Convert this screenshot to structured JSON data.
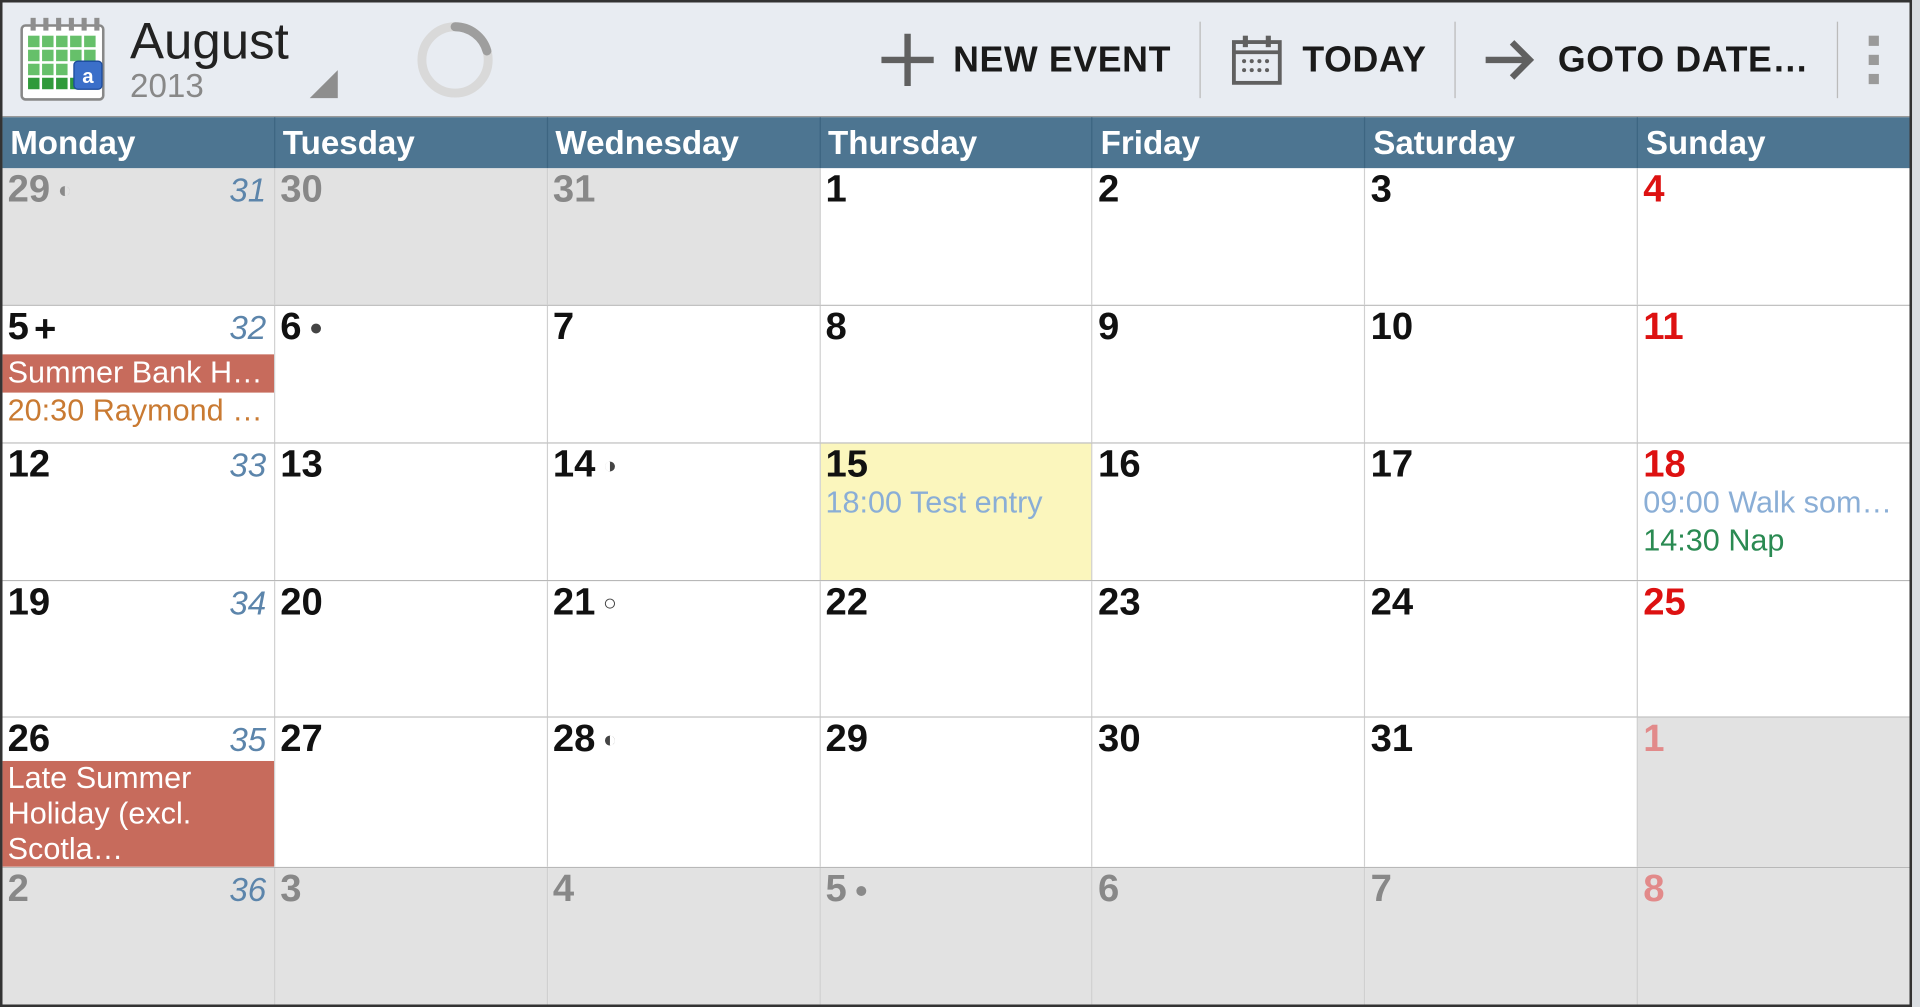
{
  "header": {
    "month": "August",
    "year": "2013",
    "actions": {
      "new_event": "NEW EVENT",
      "today": "TODAY",
      "goto_date": "GOTO DATE…"
    }
  },
  "weekdays": [
    "Monday",
    "Tuesday",
    "Wednesday",
    "Thursday",
    "Friday",
    "Saturday",
    "Sunday"
  ],
  "weeks": [
    {
      "wknum": "31",
      "days": [
        {
          "n": "29",
          "other": true,
          "moon": "◐"
        },
        {
          "n": "30",
          "other": true
        },
        {
          "n": "31",
          "other": true
        },
        {
          "n": "1"
        },
        {
          "n": "2"
        },
        {
          "n": "3"
        },
        {
          "n": "4",
          "sunday": true
        }
      ]
    },
    {
      "wknum": "32",
      "days": [
        {
          "n": "5",
          "more": true,
          "events": [
            {
              "text": "Summer Bank H…",
              "style": "banner"
            },
            {
              "text": "20:30 Raymond …",
              "style": "orange"
            }
          ]
        },
        {
          "n": "6",
          "moon": "●"
        },
        {
          "n": "7"
        },
        {
          "n": "8"
        },
        {
          "n": "9"
        },
        {
          "n": "10"
        },
        {
          "n": "11",
          "sunday": true
        }
      ]
    },
    {
      "wknum": "33",
      "days": [
        {
          "n": "12"
        },
        {
          "n": "13"
        },
        {
          "n": "14",
          "moon": "◑"
        },
        {
          "n": "15",
          "today": true,
          "events": [
            {
              "text": "18:00 Test entry",
              "style": "blue"
            }
          ]
        },
        {
          "n": "16"
        },
        {
          "n": "17"
        },
        {
          "n": "18",
          "sunday": true,
          "events": [
            {
              "text": "09:00 Walk some…",
              "style": "blue"
            },
            {
              "text": "14:30 Nap",
              "style": "green"
            }
          ]
        }
      ]
    },
    {
      "wknum": "34",
      "days": [
        {
          "n": "19"
        },
        {
          "n": "20"
        },
        {
          "n": "21",
          "moon": "○"
        },
        {
          "n": "22"
        },
        {
          "n": "23"
        },
        {
          "n": "24"
        },
        {
          "n": "25",
          "sunday": true
        }
      ]
    },
    {
      "wknum": "35",
      "days": [
        {
          "n": "26",
          "events": [
            {
              "text": "Late Summer Holiday (excl. Scotla…",
              "style": "banner",
              "wrap": true
            }
          ]
        },
        {
          "n": "27"
        },
        {
          "n": "28",
          "moon": "◐"
        },
        {
          "n": "29"
        },
        {
          "n": "30"
        },
        {
          "n": "31"
        },
        {
          "n": "1",
          "sunday": true,
          "other": true
        }
      ]
    },
    {
      "wknum": "36",
      "days": [
        {
          "n": "2",
          "other": true
        },
        {
          "n": "3",
          "other": true
        },
        {
          "n": "4",
          "other": true
        },
        {
          "n": "5",
          "other": true,
          "moon": "●"
        },
        {
          "n": "6",
          "other": true
        },
        {
          "n": "7",
          "other": true
        },
        {
          "n": "8",
          "other": true,
          "sunday": true
        }
      ]
    }
  ]
}
